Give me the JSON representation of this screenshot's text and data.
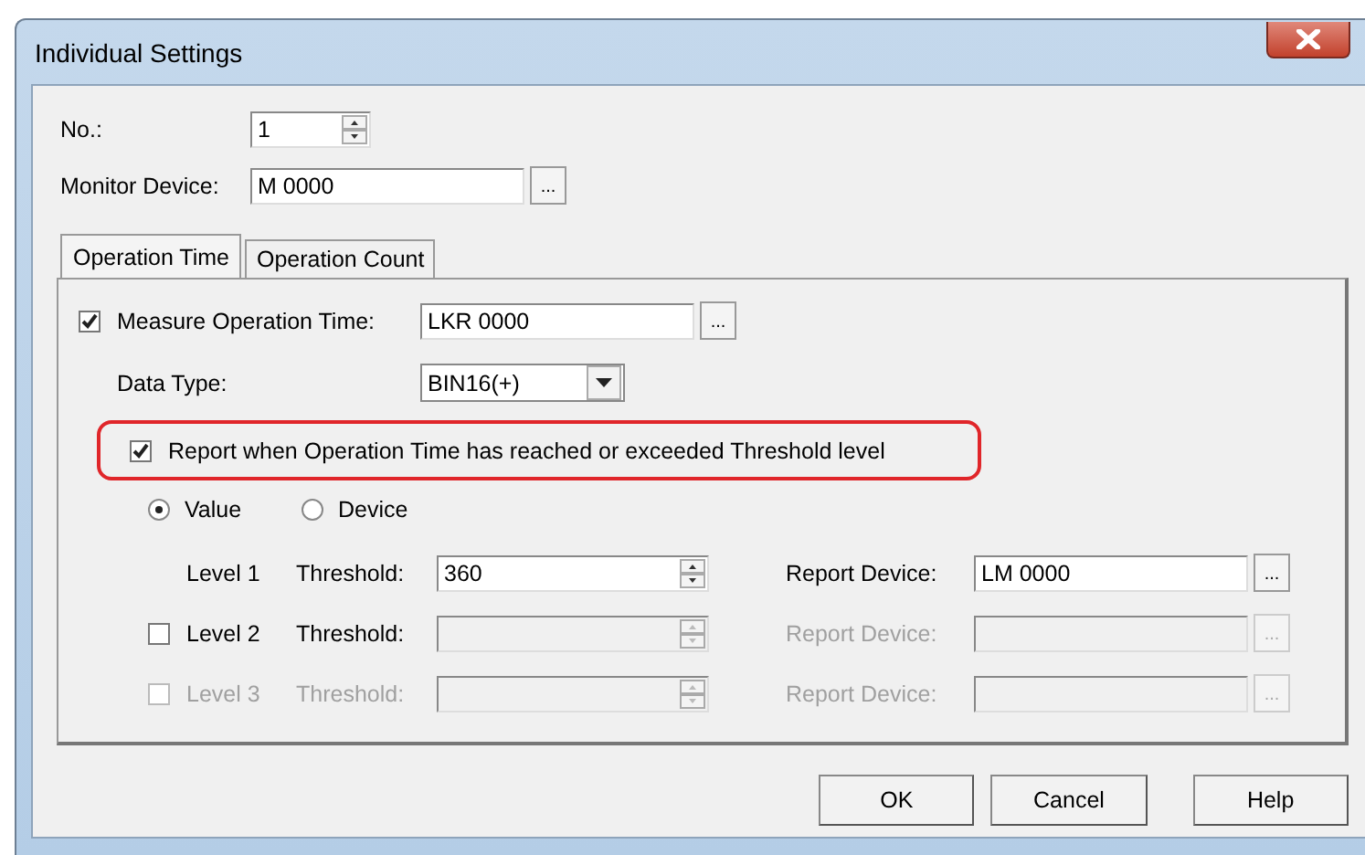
{
  "window": {
    "title": "Individual Settings"
  },
  "number": {
    "label": "No.:",
    "value": "1"
  },
  "monitor_device": {
    "label": "Monitor Device:",
    "value": "M 0000",
    "browse": "..."
  },
  "tabs": [
    {
      "label": "Operation Time",
      "selected": true
    },
    {
      "label": "Operation Count",
      "selected": false
    }
  ],
  "measure_operation_time": {
    "label": "Measure Operation Time:",
    "checked": true,
    "value": "LKR 0000",
    "browse": "..."
  },
  "data_type": {
    "label": "Data Type:",
    "value": "BIN16(+)"
  },
  "report_option": {
    "label": "Report when Operation Time has reached or exceeded Threshold level",
    "checked": true,
    "highlighted": true
  },
  "source": [
    {
      "label": "Value",
      "selected": true
    },
    {
      "label": "Device",
      "selected": false
    }
  ],
  "levels": [
    {
      "kind": "fixed",
      "label": "Level 1",
      "label_disabled": false,
      "threshold_label": "Threshold:",
      "threshold": "360",
      "report_label": "Report Device:",
      "report_device": "LM 0000",
      "browse": "...",
      "enabled": true
    },
    {
      "kind": "optional",
      "checked": false,
      "label": "Level 2",
      "label_disabled": false,
      "threshold_label": "Threshold:",
      "report_label": "Report Device:",
      "browse": "...",
      "enabled": false
    },
    {
      "kind": "optional",
      "checked": false,
      "label": "Level 3",
      "label_disabled": true,
      "threshold_label": "Threshold:",
      "report_label": "Report Device:",
      "browse": "...",
      "enabled": false
    }
  ],
  "buttons": [
    "OK",
    "Cancel",
    "Help"
  ]
}
